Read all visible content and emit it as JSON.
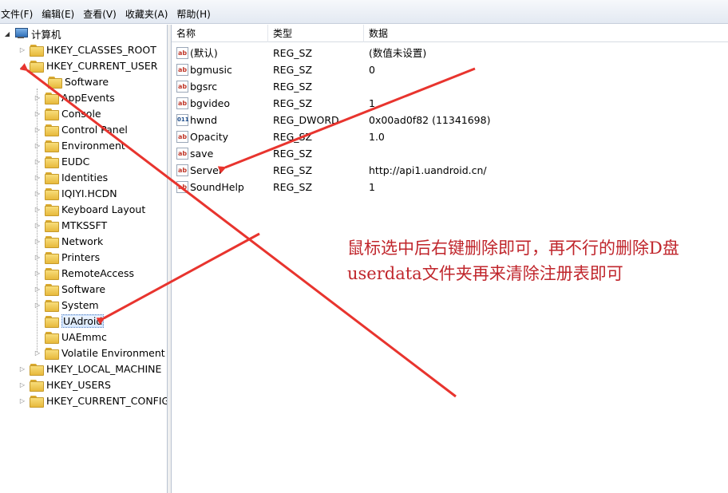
{
  "menu": [
    "文件(F)",
    "编辑(E)",
    "查看(V)",
    "收藏夹(A)",
    "帮助(H)"
  ],
  "tree": {
    "root": "计算机",
    "hives_top": [
      "HKEY_CLASSES_ROOT",
      "HKEY_CURRENT_USER"
    ],
    "current_user_children": [
      "Software",
      "AppEvents",
      "Console",
      "Control Panel",
      "Environment",
      "EUDC",
      "Identities",
      "IQIYI.HCDN",
      "Keyboard Layout",
      "MTKSSFT",
      "Network",
      "Printers",
      "RemoteAccess",
      "Software",
      "System",
      "UAdroid",
      "UAEmmc",
      "Volatile Environment"
    ],
    "selected": "UAdroid",
    "hives_bottom": [
      "HKEY_LOCAL_MACHINE",
      "HKEY_USERS",
      "HKEY_CURRENT_CONFIG"
    ]
  },
  "list": {
    "columns": [
      "名称",
      "类型",
      "数据"
    ],
    "rows": [
      {
        "icon": "ab",
        "name": "(默认)",
        "type": "REG_SZ",
        "data": "(数值未设置)"
      },
      {
        "icon": "ab",
        "name": "bgmusic",
        "type": "REG_SZ",
        "data": "0"
      },
      {
        "icon": "ab",
        "name": "bgsrc",
        "type": "REG_SZ",
        "data": ""
      },
      {
        "icon": "ab",
        "name": "bgvideo",
        "type": "REG_SZ",
        "data": "1"
      },
      {
        "icon": "011",
        "name": "hwnd",
        "type": "REG_DWORD",
        "data": "0x00ad0f82 (11341698)"
      },
      {
        "icon": "ab",
        "name": "Opacity",
        "type": "REG_SZ",
        "data": "1.0"
      },
      {
        "icon": "ab",
        "name": "save",
        "type": "REG_SZ",
        "data": ""
      },
      {
        "icon": "ab",
        "name": "Server",
        "type": "REG_SZ",
        "data": "http://api1.uandroid.cn/"
      },
      {
        "icon": "ab",
        "name": "SoundHelp",
        "type": "REG_SZ",
        "data": "1"
      }
    ]
  },
  "annotation": {
    "line1": "鼠标选中后右键删除即可，再不行的删除D盘",
    "line2": "userdata文件夹再来清除注册表即可",
    "color": "#c0262c"
  }
}
